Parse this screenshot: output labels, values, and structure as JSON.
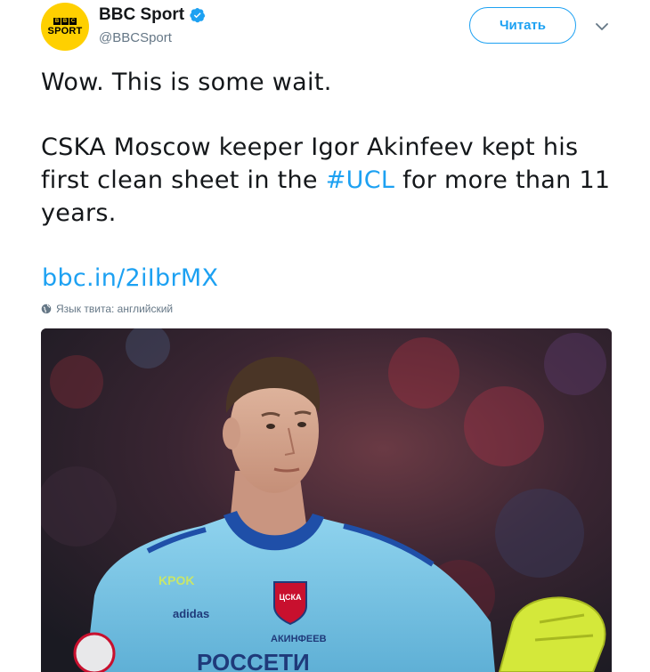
{
  "account": {
    "name": "BBC Sport",
    "handle": "@BBCSport",
    "avatar_top": [
      "B",
      "B",
      "C"
    ],
    "avatar_bottom": "SPORT",
    "verified_icon": "verified-badge-icon"
  },
  "actions": {
    "follow_label": "Читать",
    "menu_icon": "chevron-down-icon"
  },
  "tweet": {
    "line1": "Wow. This is some wait.",
    "para2_before": "CSKA Moscow keeper Igor Akinfeev kept his first clean sheet in the ",
    "hashtag": "#UCL",
    "para2_after": " for more than 11 years.",
    "link": "bbc.in/2iIbrMX",
    "language_note": "Язык твита: английский"
  },
  "photo": {
    "shirt_sponsor": "РОССЕТИ",
    "kit_brand": "KPOK",
    "maker": "adidas",
    "player_name": "АКИНФЕЕВ",
    "badge_text": "ЦСКА"
  },
  "colors": {
    "accent": "#1da1f2",
    "avatar_bg": "#ffd000",
    "muted": "#657786",
    "jersey": "#7fc8e6"
  }
}
